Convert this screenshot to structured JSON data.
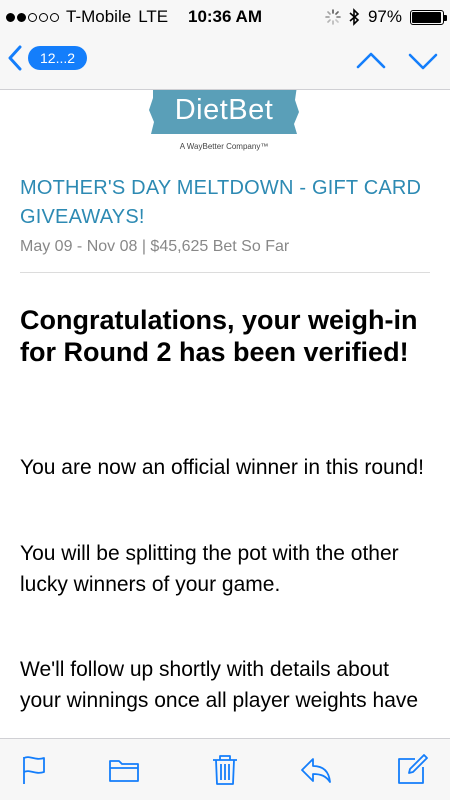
{
  "status_bar": {
    "carrier": "T-Mobile",
    "network": "LTE",
    "time": "10:36 AM",
    "battery_percent": "97%",
    "battery_level": 0.97,
    "signal_bars_filled": 2,
    "signal_bars_total": 5
  },
  "nav": {
    "back_label": "12...2",
    "icons": [
      "chevron-left-icon",
      "chevron-up-icon",
      "chevron-down-icon"
    ]
  },
  "email": {
    "logo_text": "DietBet",
    "logo_tagline": "A WayBetter Company™",
    "campaign_title": "MOTHER'S DAY MELTDOWN - GIFT CARD GIVEAWAYS!",
    "meta": "May 09 - Nov 08 | $45,625 Bet So Far",
    "headline": "Congratulations, your weigh-in for Round 2 has been verified!",
    "paragraphs": [
      "You are now an official winner in this round!",
      "You will be splitting the pot with the other lucky winners of your game.",
      "We'll follow up shortly with details about your winnings once all player weights have"
    ]
  },
  "toolbar": {
    "icons": [
      "flag-icon",
      "folder-icon",
      "trash-icon",
      "reply-icon",
      "compose-icon"
    ]
  },
  "colors": {
    "ios_blue": "#147efb",
    "campaign_teal": "#2d8ab3",
    "logo_bg": "#5a9fb8",
    "meta_gray": "#888888"
  }
}
